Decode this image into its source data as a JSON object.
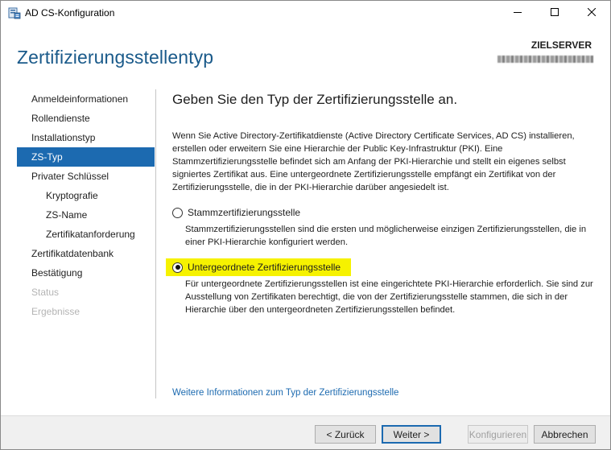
{
  "window": {
    "title": "AD CS-Konfiguration"
  },
  "header": {
    "title": "Zertifizierungsstellentyp",
    "server_label": "ZIELSERVER"
  },
  "nav": {
    "items": [
      {
        "label": "Anmeldeinformationen",
        "level": 0,
        "state": "normal"
      },
      {
        "label": "Rollendienste",
        "level": 0,
        "state": "normal"
      },
      {
        "label": "Installationstyp",
        "level": 0,
        "state": "normal"
      },
      {
        "label": "ZS-Typ",
        "level": 0,
        "state": "active"
      },
      {
        "label": "Privater Schlüssel",
        "level": 0,
        "state": "normal"
      },
      {
        "label": "Kryptografie",
        "level": 1,
        "state": "normal"
      },
      {
        "label": "ZS-Name",
        "level": 1,
        "state": "normal"
      },
      {
        "label": "Zertifikatanforderung",
        "level": 1,
        "state": "normal"
      },
      {
        "label": "Zertifikatdatenbank",
        "level": 0,
        "state": "normal"
      },
      {
        "label": "Bestätigung",
        "level": 0,
        "state": "normal"
      },
      {
        "label": "Status",
        "level": 0,
        "state": "disabled"
      },
      {
        "label": "Ergebnisse",
        "level": 0,
        "state": "disabled"
      }
    ]
  },
  "content": {
    "heading": "Geben Sie den Typ der Zertifizierungsstelle an.",
    "intro": "Wenn Sie Active Directory-Zertifikatdienste (Active Directory Certificate Services, AD CS) installieren, erstellen oder erweitern Sie eine Hierarchie der Public Key-Infrastruktur (PKI). Eine Stammzertifizierungsstelle befindet sich am Anfang der PKI-Hierarchie und stellt ein eigenes selbst signiertes Zertifikat aus. Eine untergeordnete Zertifizierungsstelle empfängt ein Zertifikat von der Zertifizierungsstelle, die in der PKI-Hierarchie darüber angesiedelt ist.",
    "options": [
      {
        "label": "Stammzertifizierungsstelle",
        "selected": false,
        "description": "Stammzertifizierungsstellen sind die ersten und möglicherweise einzigen Zertifizierungsstellen, die in einer PKI-Hierarchie konfiguriert werden."
      },
      {
        "label": "Untergeordnete Zertifizierungsstelle",
        "selected": true,
        "description": "Für untergeordnete Zertifizierungsstellen ist eine eingerichtete PKI-Hierarchie erforderlich. Sie sind zur Ausstellung von Zertifikaten berechtigt, die von der Zertifizierungsstelle stammen, die sich in der Hierarchie über den untergeordneten Zertifizierungsstellen befindet."
      }
    ],
    "more_link": "Weitere Informationen zum Typ der Zertifizierungsstelle"
  },
  "footer": {
    "back": "< Zurück",
    "next": "Weiter >",
    "configure": "Konfigurieren",
    "cancel": "Abbrechen"
  },
  "colors": {
    "accent": "#1c6ab0",
    "header_title": "#1a5a8a",
    "highlight": "#f6f200",
    "disabled_text": "#b4b4b4"
  },
  "icons": {
    "app": "server-manager-icon",
    "minimize": "minimize-icon",
    "maximize": "maximize-icon",
    "close": "close-icon"
  }
}
